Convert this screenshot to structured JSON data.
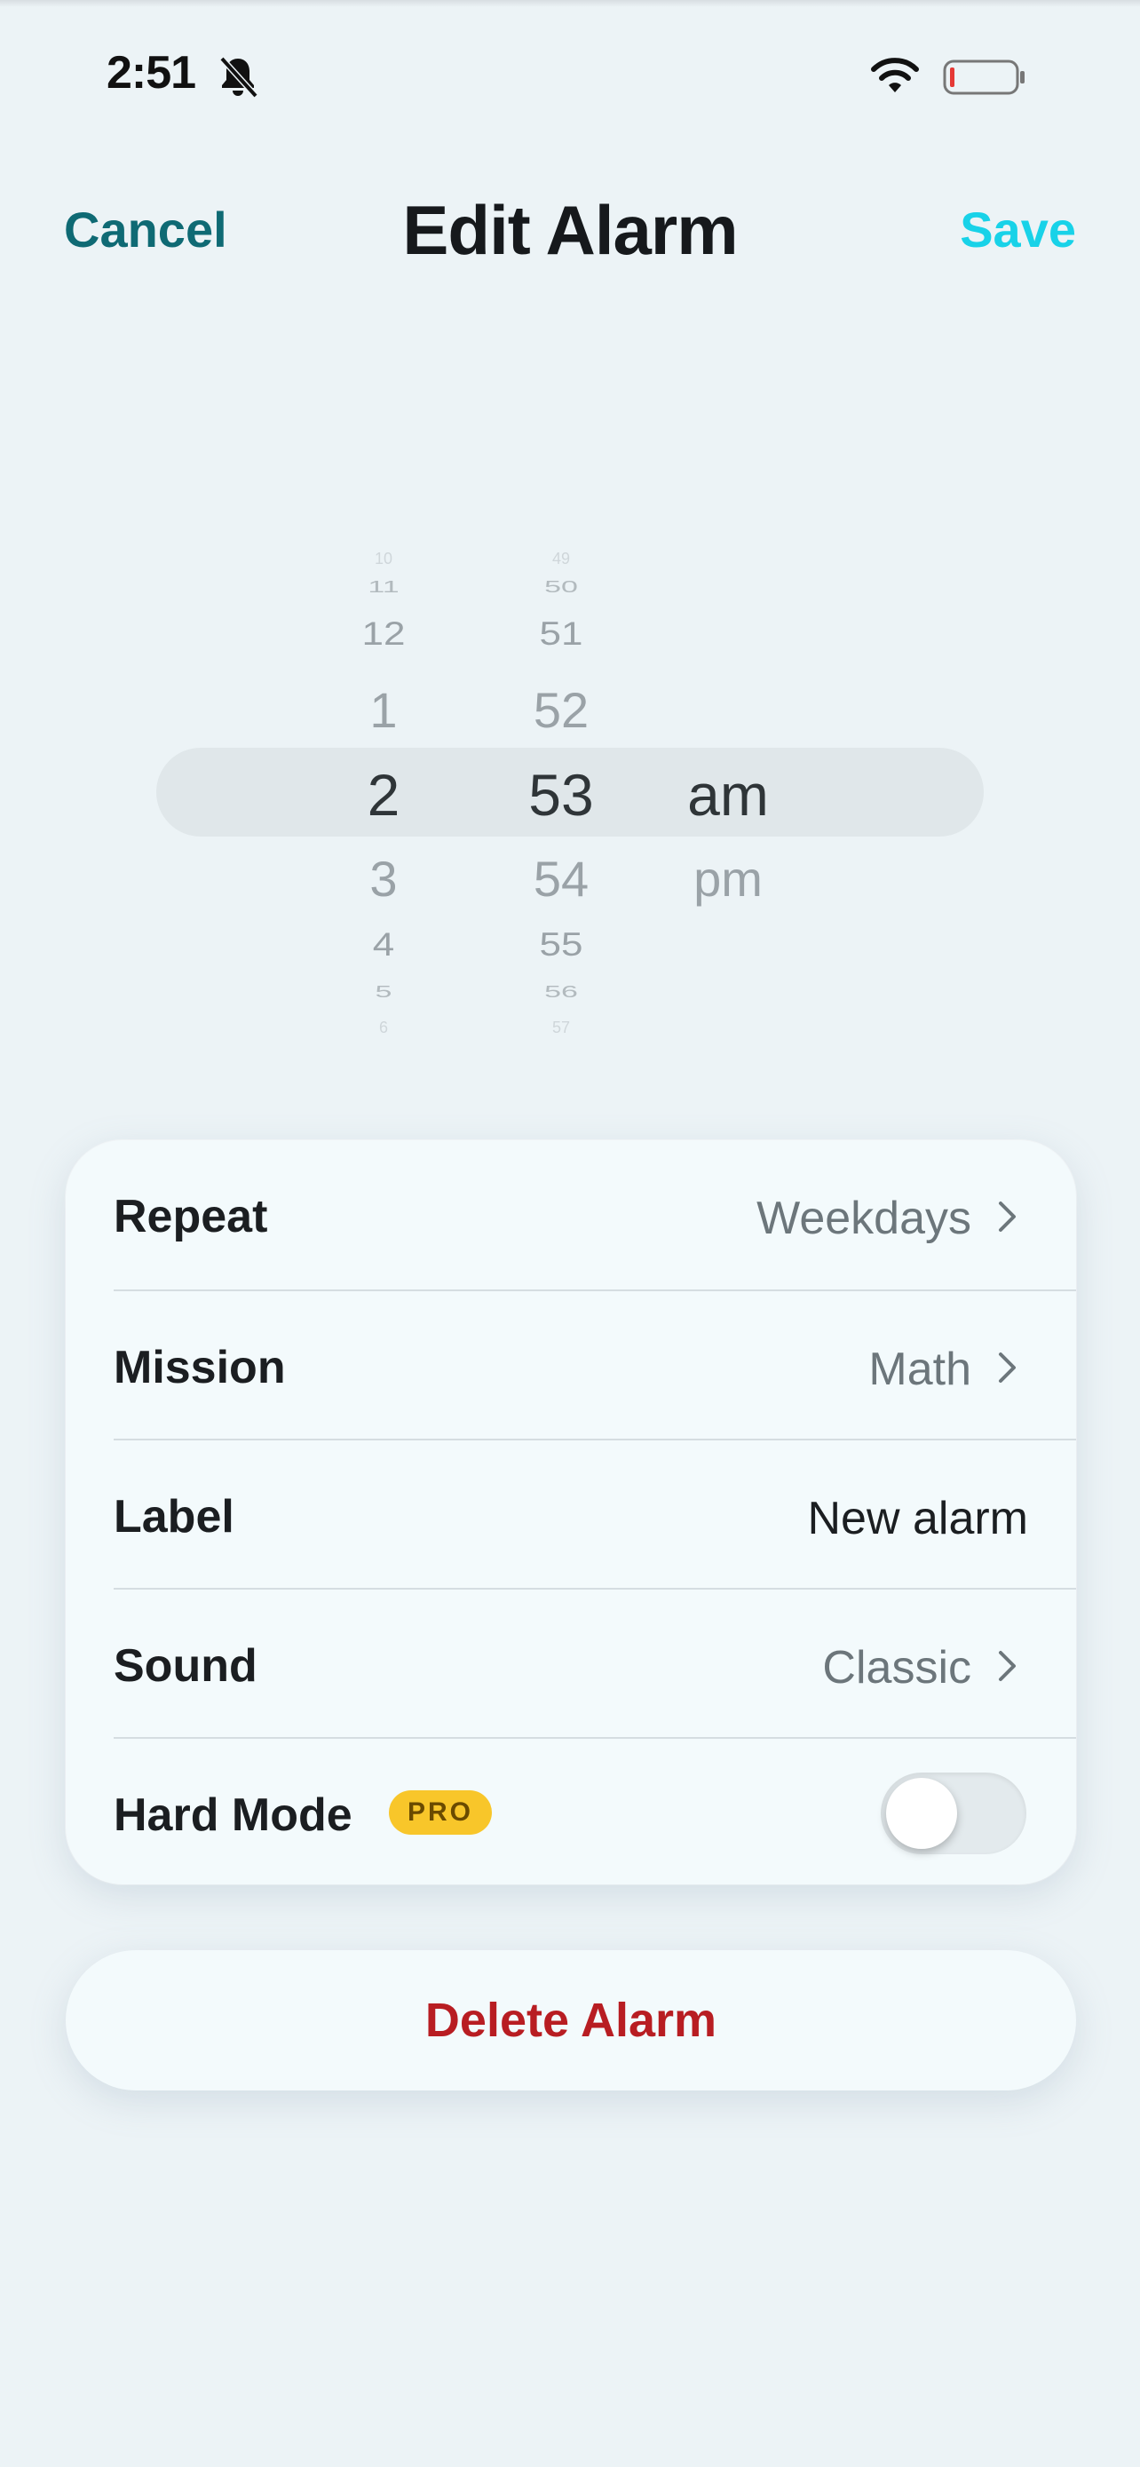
{
  "status_bar": {
    "time": "2:51"
  },
  "header": {
    "cancel_label": "Cancel",
    "title": "Edit Alarm",
    "save_label": "Save"
  },
  "picker": {
    "hours": [
      "10",
      "11",
      "12",
      "1",
      "2",
      "3",
      "4",
      "5",
      "6"
    ],
    "minutes": [
      "49",
      "50",
      "51",
      "52",
      "53",
      "54",
      "55",
      "56",
      "57"
    ],
    "meridiem": [
      "am",
      "pm"
    ],
    "selected_hour": "2",
    "selected_minute": "53",
    "selected_meridiem": "am"
  },
  "settings": {
    "repeat": {
      "label": "Repeat",
      "value": "Weekdays"
    },
    "mission": {
      "label": "Mission",
      "value": "Math"
    },
    "alarm_label": {
      "label": "Label",
      "value": "New alarm"
    },
    "sound": {
      "label": "Sound",
      "value": "Classic"
    },
    "hard_mode": {
      "label": "Hard Mode",
      "badge": "PRO",
      "enabled": false
    }
  },
  "delete_label": "Delete Alarm",
  "colors": {
    "background": "#ecf3f6",
    "accent_cancel": "#0f6a74",
    "accent_save": "#18d2e8",
    "destructive": "#b81d22",
    "pro_badge": "#f8c62a",
    "battery_low": "#e53935"
  },
  "icons": [
    "bell-slash-icon",
    "wifi-icon",
    "battery-icon",
    "chevron-right-icon"
  ]
}
